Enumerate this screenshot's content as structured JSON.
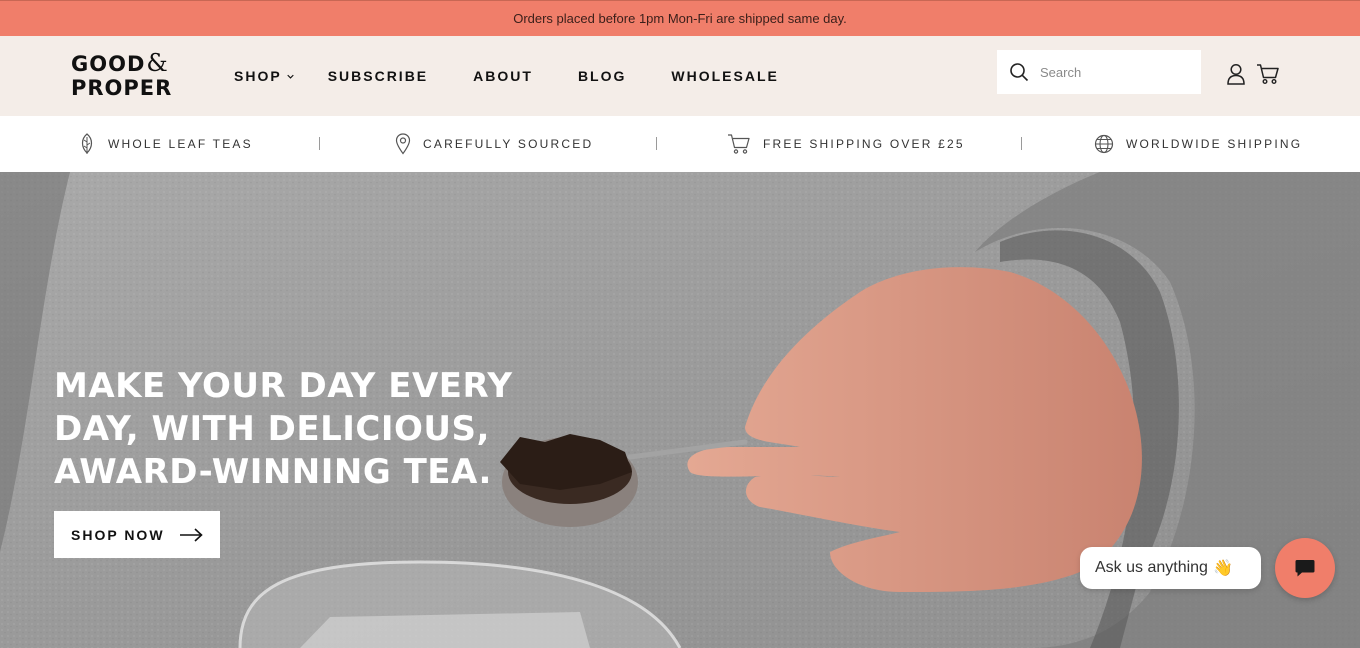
{
  "announcement": {
    "text": "Orders placed before 1pm Mon-Fri are shipped same day."
  },
  "header": {
    "logo": {
      "line1": "GOOD",
      "amp": "&",
      "line2": "PROPER"
    },
    "nav": [
      {
        "label": "SHOP",
        "has_dropdown": true
      },
      {
        "label": "SUBSCRIBE"
      },
      {
        "label": "ABOUT"
      },
      {
        "label": "BLOG"
      },
      {
        "label": "WHOLESALE"
      }
    ],
    "search": {
      "placeholder": "Search",
      "value": ""
    },
    "icons": [
      "search-icon",
      "account-icon",
      "cart-icon"
    ]
  },
  "features": [
    {
      "icon": "leaf-icon",
      "label": "WHOLE LEAF TEAS"
    },
    {
      "icon": "location-pin-icon",
      "label": "CAREFULLY SOURCED"
    },
    {
      "icon": "cart-icon",
      "label": "FREE SHIPPING OVER £25"
    },
    {
      "icon": "globe-icon",
      "label": "WORLDWIDE SHIPPING"
    }
  ],
  "hero": {
    "headline": "Make your day every day, with delicious, award-winning tea.",
    "cta_label": "SHOP NOW"
  },
  "chat": {
    "bubble_text": "Ask us anything",
    "bubble_emoji": "👋"
  },
  "colors": {
    "accent": "#f07e6a",
    "header_bg": "#f4ede8",
    "text": "#111111"
  }
}
